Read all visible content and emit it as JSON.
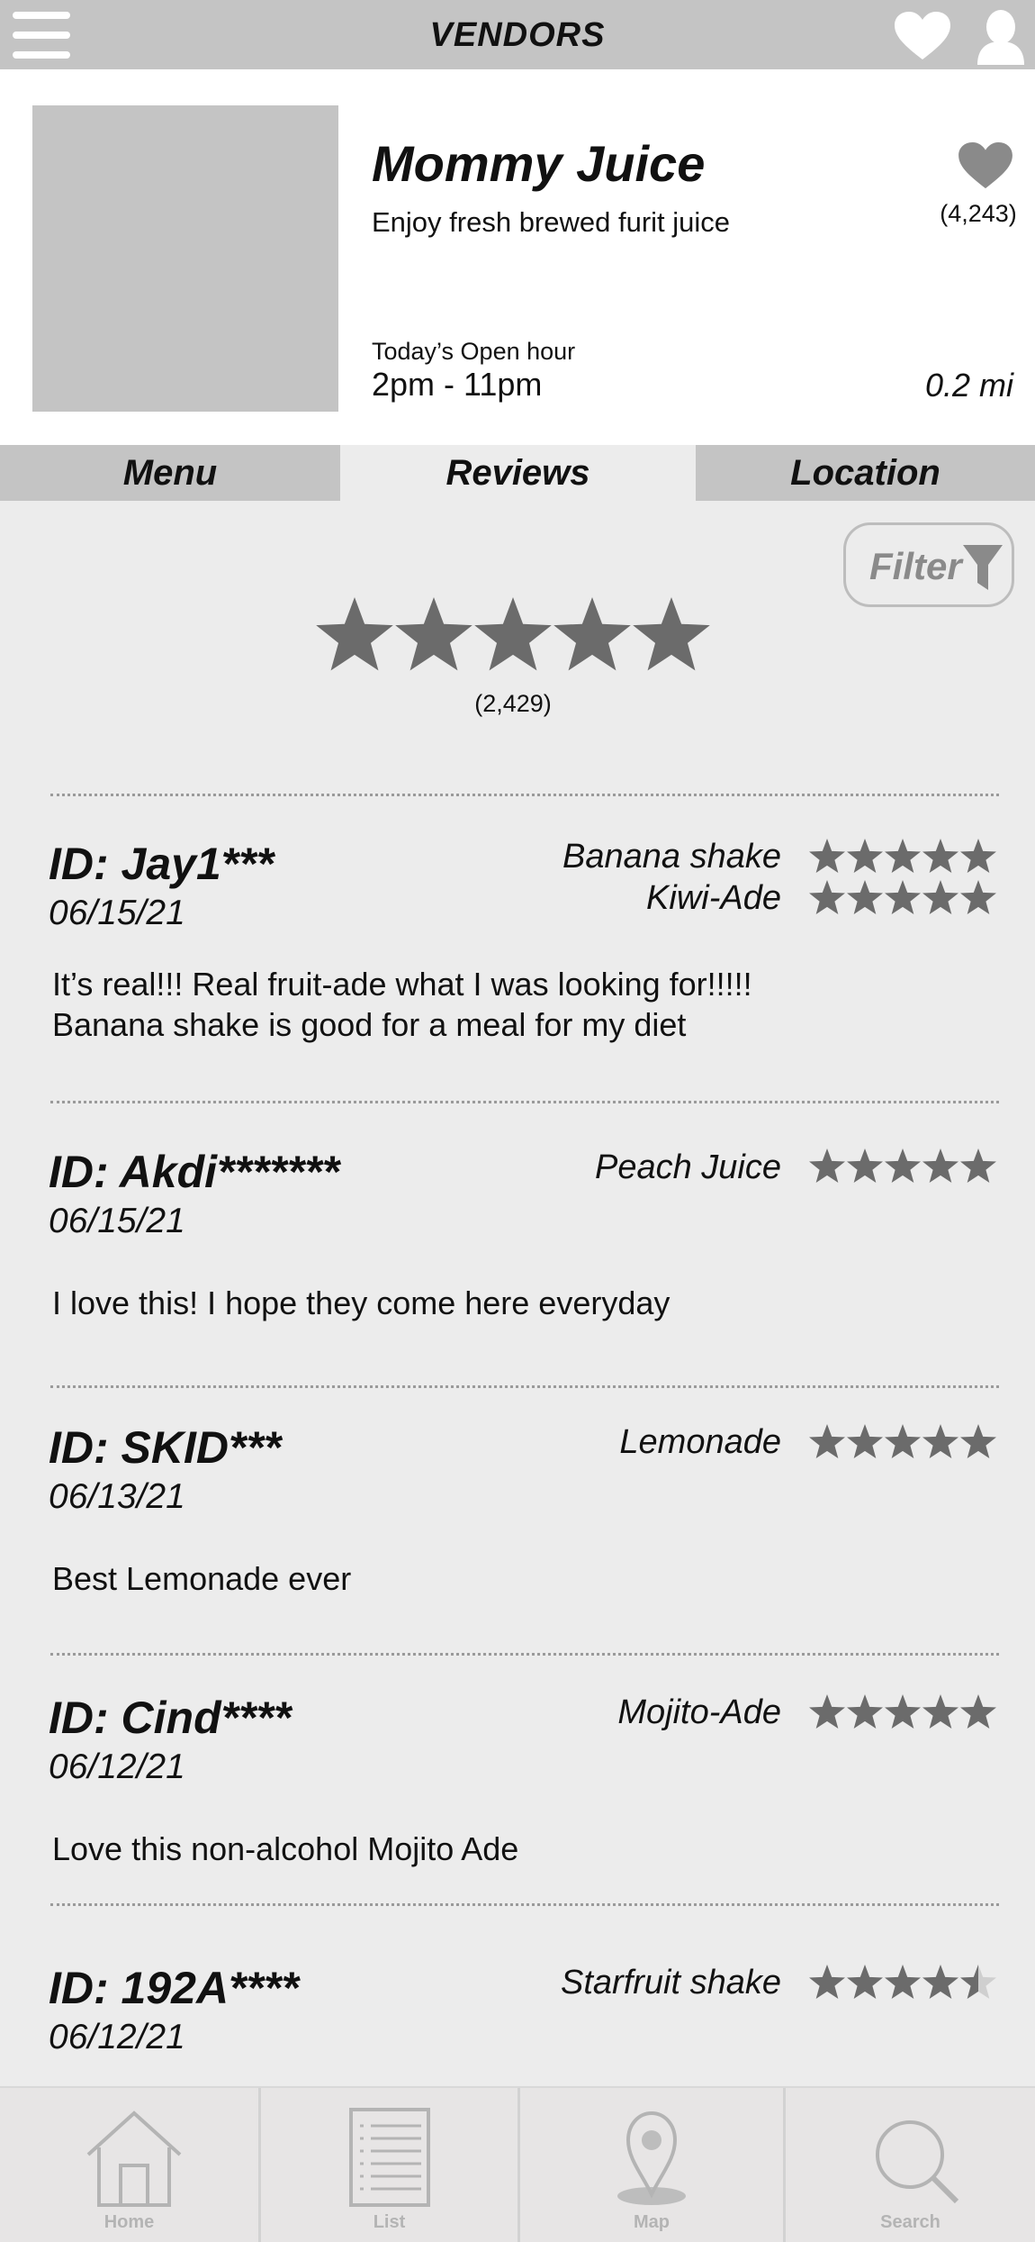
{
  "topbar": {
    "title": "VENDORS"
  },
  "vendor": {
    "name": "Mommy Juice",
    "tagline": "Enjoy fresh brewed furit juice",
    "favorites_count": "(4,243)",
    "open_label": "Today’s Open hour",
    "open_hours": "2pm - 11pm",
    "distance": "0.2 mi"
  },
  "tabs": [
    {
      "label": "Menu"
    },
    {
      "label": "Reviews"
    },
    {
      "label": "Location"
    }
  ],
  "active_tab": "Reviews",
  "filter": {
    "label": "Filter"
  },
  "overall": {
    "rating": 5,
    "count": "(2,429)"
  },
  "reviews": [
    {
      "id": "ID: Jay1***",
      "date": "06/15/21",
      "items": [
        {
          "name": "Banana shake",
          "rating": 5
        },
        {
          "name": "Kiwi-Ade",
          "rating": 5
        }
      ],
      "text_lines": [
        "It’s real!!! Real fruit-ade what I was looking for!!!!!",
        "Banana shake is good for a meal for my diet"
      ]
    },
    {
      "id": "ID: Akdi*******",
      "date": "06/15/21",
      "items": [
        {
          "name": "Peach Juice",
          "rating": 5
        }
      ],
      "text_lines": [
        "I love this! I hope they come here everyday"
      ]
    },
    {
      "id": "ID: SKID***",
      "date": "06/13/21",
      "items": [
        {
          "name": "Lemonade",
          "rating": 5
        }
      ],
      "text_lines": [
        "Best Lemonade ever"
      ]
    },
    {
      "id": "ID: Cind****",
      "date": "06/12/21",
      "items": [
        {
          "name": "Mojito-Ade",
          "rating": 5
        }
      ],
      "text_lines": [
        "Love this non-alcohol Mojito Ade"
      ]
    },
    {
      "id": "ID: 192A****",
      "date": "06/12/21",
      "items": [
        {
          "name": "Starfruit shake",
          "rating": 4.5
        }
      ],
      "text_lines": []
    }
  ],
  "bottom_nav": [
    {
      "label": "Home",
      "icon": "home-icon"
    },
    {
      "label": "List",
      "icon": "list-icon"
    },
    {
      "label": "Map",
      "icon": "map-pin-icon"
    },
    {
      "label": "Search",
      "icon": "search-icon"
    }
  ],
  "colors": {
    "bar_gray": "#c4c4c4",
    "background": "#ececec",
    "star": "#6b6b6b",
    "star_empty": "#cfcfcf"
  }
}
